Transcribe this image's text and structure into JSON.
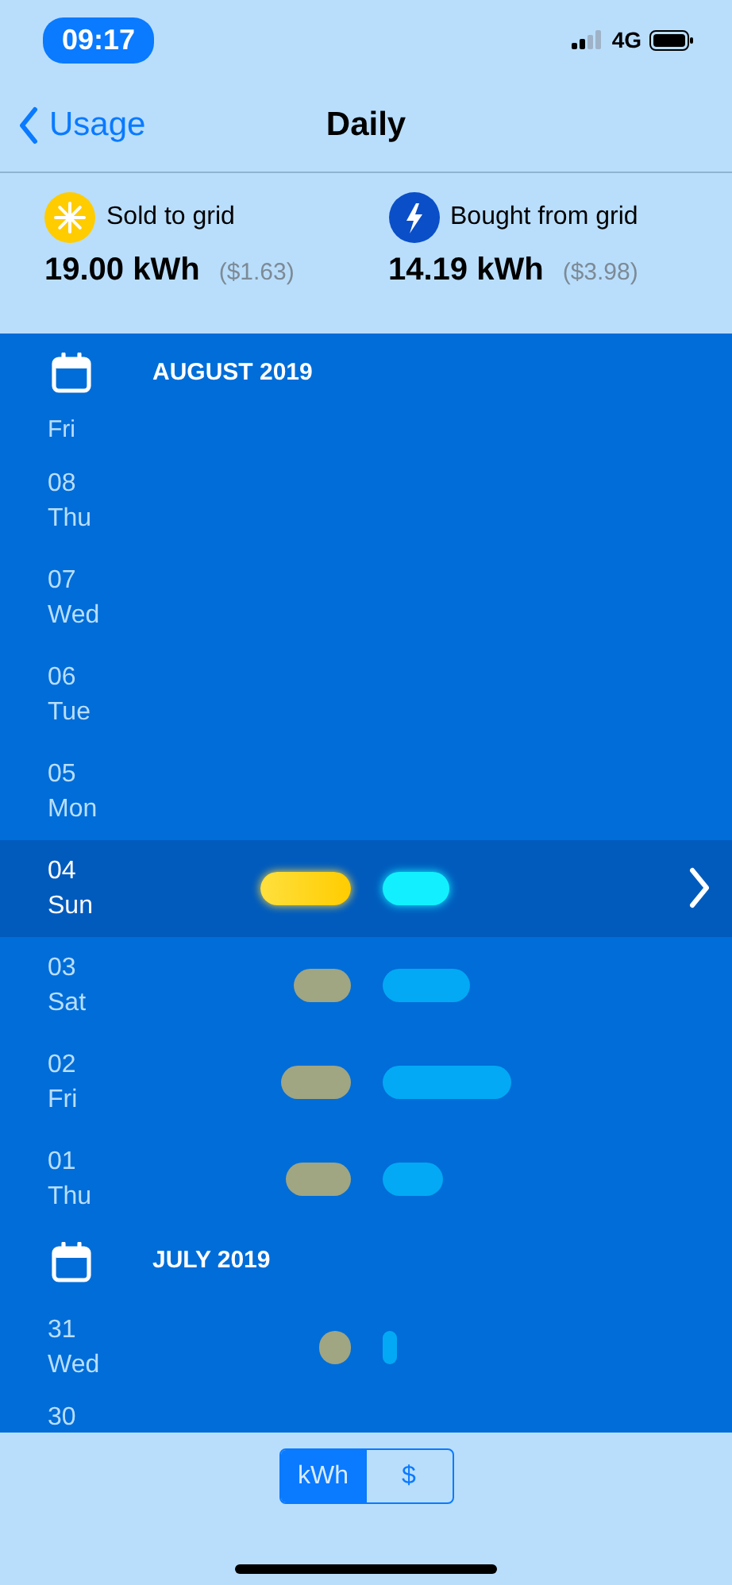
{
  "status_bar": {
    "time": "09:17",
    "network": "4G"
  },
  "nav": {
    "back": "Usage",
    "title": "Daily"
  },
  "summary": [
    {
      "kind": "sold",
      "label": "Sold to grid",
      "amount": "19.00 kWh",
      "cost": "($1.63)"
    },
    {
      "kind": "bought",
      "label": "Bought from grid",
      "amount": "14.19 kWh",
      "cost": "($3.98)"
    }
  ],
  "sections": [
    {
      "month": "AUGUST 2019",
      "rows": [
        {
          "kind": "partial_top",
          "weekday": "Fri"
        },
        {
          "kind": "day",
          "day": "08",
          "weekday": "Thu",
          "selected": false
        },
        {
          "kind": "day",
          "day": "07",
          "weekday": "Wed",
          "selected": false
        },
        {
          "kind": "day",
          "day": "06",
          "weekday": "Tue",
          "selected": false
        },
        {
          "kind": "day",
          "day": "05",
          "weekday": "Mon",
          "selected": false
        },
        {
          "kind": "day",
          "day": "04",
          "weekday": "Sun",
          "selected": true
        },
        {
          "kind": "day",
          "day": "03",
          "weekday": "Sat",
          "selected": false
        },
        {
          "kind": "day",
          "day": "02",
          "weekday": "Fri",
          "selected": false
        },
        {
          "kind": "day",
          "day": "01",
          "weekday": "Thu",
          "selected": false
        }
      ]
    },
    {
      "month": "JULY 2019",
      "rows": [
        {
          "kind": "day",
          "day": "31",
          "weekday": "Wed",
          "selected": false
        },
        {
          "kind": "partial_bottom",
          "day": "30"
        }
      ]
    }
  ],
  "unit_toggle": [
    {
      "label": "kWh",
      "selected": true
    },
    {
      "label": "$",
      "selected": false
    }
  ]
}
